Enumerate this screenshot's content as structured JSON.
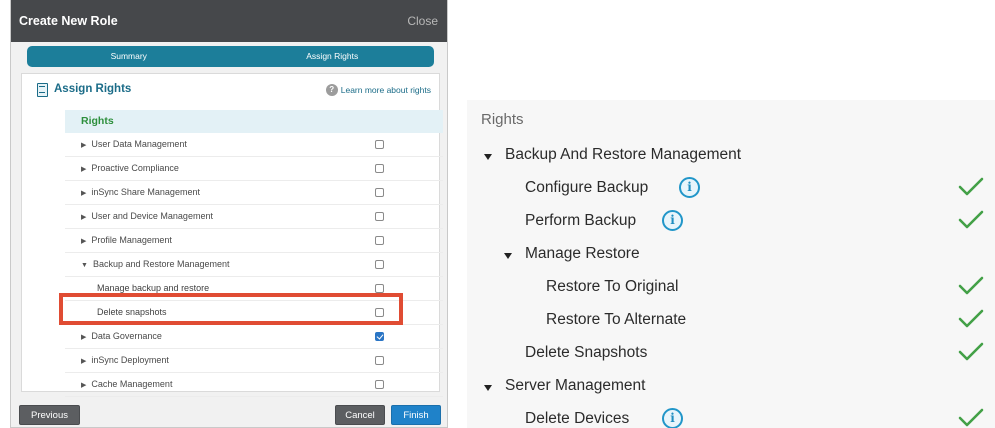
{
  "dialog": {
    "title": "Create New Role",
    "close_label": "Close",
    "wizard_steps": [
      "Summary",
      "Assign Rights"
    ],
    "section_title": "Assign Rights",
    "learn_more": "Learn more about rights",
    "rights_header": "Rights",
    "rights": [
      {
        "label": "User Data Management",
        "expand": "collapsed",
        "child": false,
        "checked": false
      },
      {
        "label": "Proactive Compliance",
        "expand": "collapsed",
        "child": false,
        "checked": false
      },
      {
        "label": "inSync Share Management",
        "expand": "collapsed",
        "child": false,
        "checked": false
      },
      {
        "label": "User and Device Management",
        "expand": "collapsed",
        "child": false,
        "checked": false
      },
      {
        "label": "Profile Management",
        "expand": "collapsed",
        "child": false,
        "checked": false
      },
      {
        "label": "Backup and Restore Management",
        "expand": "expanded",
        "child": false,
        "checked": false
      },
      {
        "label": "Manage backup and restore",
        "expand": "none",
        "child": true,
        "checked": false
      },
      {
        "label": "Delete snapshots",
        "expand": "none",
        "child": true,
        "checked": false
      },
      {
        "label": "Data Governance",
        "expand": "collapsed",
        "child": false,
        "checked": true
      },
      {
        "label": "inSync Deployment",
        "expand": "collapsed",
        "child": false,
        "checked": false
      },
      {
        "label": "Cache Management",
        "expand": "collapsed",
        "child": false,
        "checked": false
      }
    ],
    "buttons": {
      "previous": "Previous",
      "cancel": "Cancel",
      "finish": "Finish"
    }
  },
  "rights_view": {
    "title": "Rights",
    "items": [
      {
        "label": "Backup And Restore Management",
        "level": 0,
        "caret": true,
        "info": false,
        "granted": false
      },
      {
        "label": "Configure Backup",
        "level": 1,
        "caret": false,
        "info": true,
        "granted": true
      },
      {
        "label": "Perform Backup",
        "level": 1,
        "caret": false,
        "info": true,
        "granted": true
      },
      {
        "label": "Manage Restore",
        "level": 1,
        "caret": true,
        "info": false,
        "granted": false
      },
      {
        "label": "Restore To Original",
        "level": 2,
        "caret": false,
        "info": false,
        "granted": true
      },
      {
        "label": "Restore To Alternate",
        "level": 2,
        "caret": false,
        "info": false,
        "granted": true
      },
      {
        "label": "Delete Snapshots",
        "level": 1,
        "caret": false,
        "info": false,
        "granted": true
      },
      {
        "label": "Server Management",
        "level": 0,
        "caret": true,
        "info": false,
        "granted": false
      },
      {
        "label": "Delete Devices",
        "level": 1,
        "caret": false,
        "info": true,
        "granted": true
      }
    ]
  },
  "colors": {
    "header_bg": "#46484b",
    "wizard_bg": "#1c7e9a",
    "rights_green": "#2d8f3c",
    "highlight_red": "#e04c33",
    "checkmark_green": "#43a047",
    "info_blue": "#2196c9"
  },
  "icons": {
    "assign": "assign-rights-icon",
    "learn": "help-icon",
    "info": "info-icon",
    "granted": "checkmark-icon",
    "tree": "caret-down-icon"
  }
}
